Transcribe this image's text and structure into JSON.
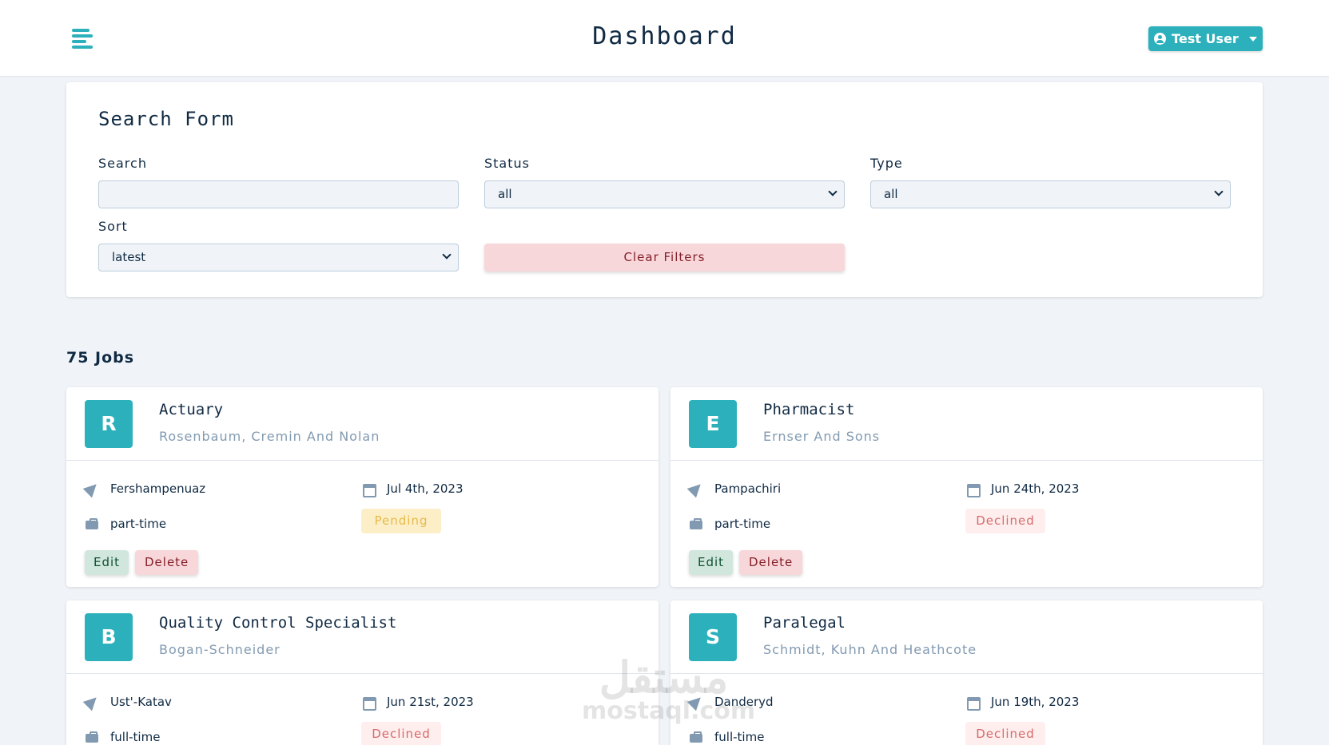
{
  "navbar": {
    "title": "Dashboard",
    "user_label": "Test User",
    "accent_color": "#2cb1bc"
  },
  "search_form": {
    "title": "Search Form",
    "search_label": "Search",
    "search_value": "",
    "status_label": "Status",
    "status_value": "all",
    "type_label": "Type",
    "type_value": "all",
    "sort_label": "Sort",
    "sort_value": "latest",
    "clear_label": "Clear Filters"
  },
  "jobs": {
    "count_label": "75 Jobs",
    "actions": {
      "edit_label": "Edit",
      "delete_label": "Delete"
    },
    "items": [
      {
        "initial": "R",
        "position": "Actuary",
        "company": "Rosenbaum, Cremin And Nolan",
        "location": "Fershampenuaz",
        "date": "Jul 4th, 2023",
        "type": "part-time",
        "status": "Pending"
      },
      {
        "initial": "E",
        "position": "Pharmacist",
        "company": "Ernser And Sons",
        "location": "Pampachiri",
        "date": "Jun 24th, 2023",
        "type": "part-time",
        "status": "Declined"
      },
      {
        "initial": "B",
        "position": "Quality Control Specialist",
        "company": "Bogan-Schneider",
        "location": "Ust'-Katav",
        "date": "Jun 21st, 2023",
        "type": "full-time",
        "status": "Declined"
      },
      {
        "initial": "S",
        "position": "Paralegal",
        "company": "Schmidt, Kuhn And Heathcote",
        "location": "Danderyd",
        "date": "Jun 19th, 2023",
        "type": "full-time",
        "status": "Declined"
      }
    ]
  },
  "watermark": {
    "text_ar": "مستقل",
    "text_en": "mostaql.com"
  }
}
